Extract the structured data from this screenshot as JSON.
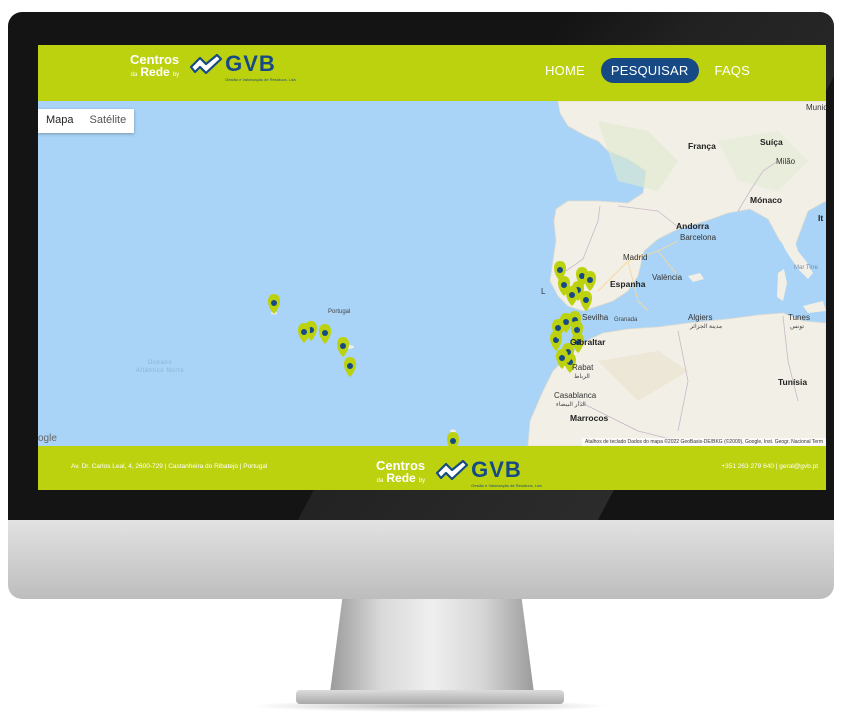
{
  "brand": {
    "centros_line1": "Centros",
    "centros_prefix": "da",
    "centros_line2": "Rede",
    "centros_suffix": "by",
    "logo": "GVB",
    "logo_sub": "Gestão e Valorização de Resíduos, Lda"
  },
  "nav": {
    "items": [
      {
        "label": "HOME",
        "active": false
      },
      {
        "label": "PESQUISAR",
        "active": true
      },
      {
        "label": "FAQS",
        "active": false
      }
    ]
  },
  "map": {
    "type_options": [
      "Mapa",
      "Satélite"
    ],
    "labels": {
      "franca": "França",
      "suica": "Suíça",
      "munique": "Muniq",
      "milao": "Milão",
      "monaco": "Mónaco",
      "it": "It",
      "andorra": "Andorra",
      "barcelona": "Barcelona",
      "madrid": "Madrid",
      "valencia": "València",
      "espanha": "Espanha",
      "mar_tirreno": "Mar Tirre",
      "sevilha": "Sevilha",
      "granada": "Granada",
      "gibraltar": "Gibraltar",
      "algiers": "Algiers",
      "algiers_ar": "مدينة الجزائر",
      "tunes": "Tunes",
      "tunes_ar": "تونس",
      "rabat": "Rabat",
      "rabat_ar": "الرباط",
      "casablanca": "Casablanca",
      "casablanca_ar": "الدار البيضاء",
      "marrocos": "Marrocos",
      "tunisia": "Tunísia",
      "portugal": "Portugal",
      "lisboa_l": "L",
      "ocean": "Oceano Atlântico Norte"
    },
    "google": "ogle",
    "attribution": "Atalhos de teclado   Dados do mapa ©2022 GeoBasis-DE/BKG (©2009), Google, Inst. Geogr. Nacional   Term"
  },
  "footer": {
    "address": "Av. Dr. Carlos Leal, 4, 2600-729 | Castanheira do Ribatejo | Portugal",
    "contact": "+351 263 279 640 | geral@gvb.pt"
  },
  "colors": {
    "brand_green": "#bdd20f",
    "brand_blue": "#174a85",
    "ocean": "#a9d4f7",
    "land": "#f2efe6"
  }
}
